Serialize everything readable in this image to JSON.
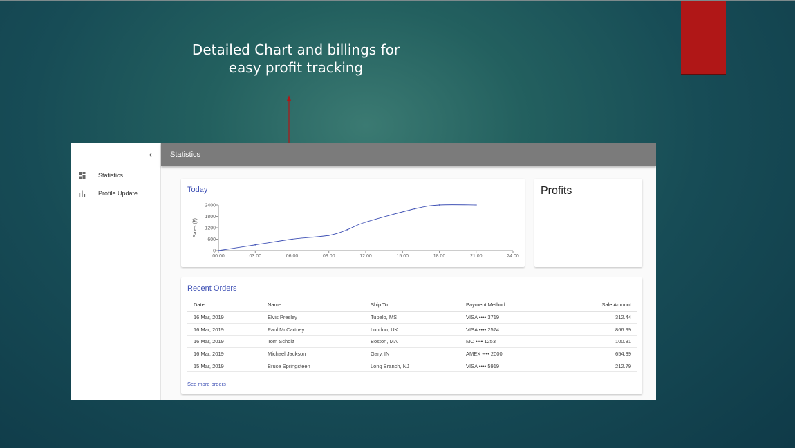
{
  "slide": {
    "title": "Detailed Chart and billings for\neasy profit tracking",
    "accent_color": "#b01717"
  },
  "app": {
    "sidebar": {
      "collapse_icon": "chevron-left-icon",
      "items": [
        {
          "label": "Statistics",
          "icon": "dashboard-icon"
        },
        {
          "label": "Profile Update",
          "icon": "bar-chart-icon"
        }
      ]
    },
    "topbar": {
      "title": "Statistics",
      "color": "#7b7b7b"
    },
    "profits": {
      "title": "Profits"
    },
    "orders": {
      "title": "Recent Orders",
      "columns": [
        "Date",
        "Name",
        "Ship To",
        "Payment Method",
        "Sale Amount"
      ],
      "rows": [
        [
          "16 Mar, 2019",
          "Elvis Presley",
          "Tupelo, MS",
          "VISA  •••• 3719",
          "312.44"
        ],
        [
          "16 Mar, 2019",
          "Paul McCartney",
          "London, UK",
          "VISA  •••• 2574",
          "866.99"
        ],
        [
          "16 Mar, 2019",
          "Tom Scholz",
          "Boston, MA",
          "MC  •••• 1253",
          "100.81"
        ],
        [
          "16 Mar, 2019",
          "Michael Jackson",
          "Gary, IN",
          "AMEX  •••• 2000",
          "654.39"
        ],
        [
          "15 Mar, 2019",
          "Bruce Springsteen",
          "Long Branch, NJ",
          "VISA  •••• 5919",
          "212.79"
        ]
      ],
      "see_more": "See more orders"
    }
  },
  "chart_data": {
    "type": "line",
    "title": "Today",
    "xlabel": "",
    "ylabel": "Sales ($)",
    "x_ticks": [
      "00:00",
      "03:00",
      "06:00",
      "09:00",
      "12:00",
      "15:00",
      "18:00",
      "21:00",
      "24:00"
    ],
    "y_ticks": [
      0,
      600,
      1200,
      1800,
      2400
    ],
    "ylim": [
      0,
      2400
    ],
    "xlim_hours": [
      0,
      24
    ],
    "series": [
      {
        "color": "#3f51b5",
        "x": [
          0,
          3,
          6,
          9,
          10.5,
          12,
          16,
          18,
          21
        ],
        "y": [
          0,
          300,
          600,
          800,
          1100,
          1500,
          2200,
          2400,
          2400
        ]
      }
    ],
    "grid": false
  }
}
